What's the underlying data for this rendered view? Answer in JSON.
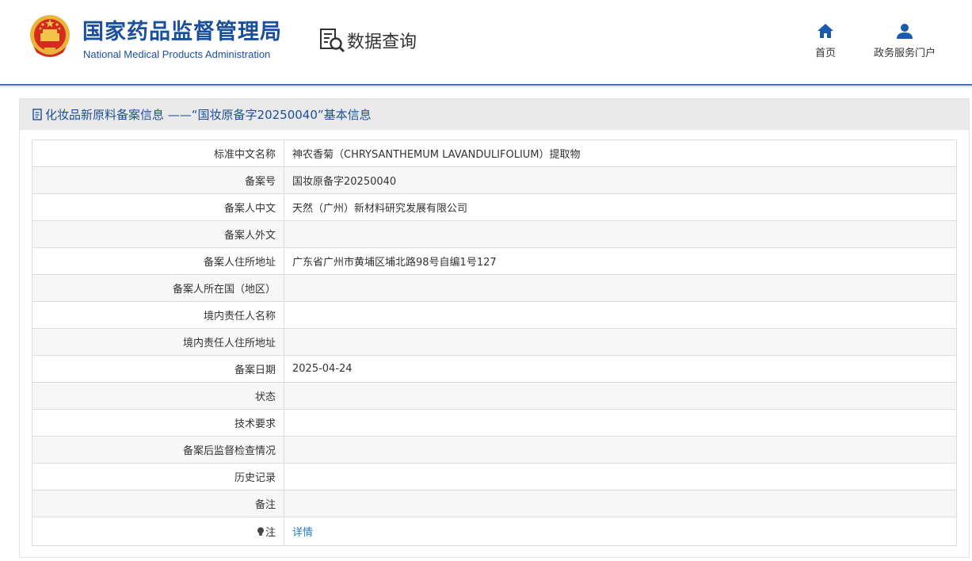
{
  "header": {
    "org_cn": "国家药品监督管理局",
    "org_en": "National Medical Products Administration",
    "query_title": "数据查询",
    "nav": {
      "home": "首页",
      "portal": "政务服务门户"
    }
  },
  "panel": {
    "title": "化妆品新原料备案信息 ——“国妆原备字20250040”基本信息"
  },
  "rows": [
    {
      "label": "标准中文名称",
      "value": "神农香菊（CHRYSANTHEMUM LAVANDULIFOLIUM）提取物"
    },
    {
      "label": "备案号",
      "value": "国妆原备字20250040"
    },
    {
      "label": "备案人中文",
      "value": "天然（广州）新材料研究发展有限公司"
    },
    {
      "label": "备案人外文",
      "value": ""
    },
    {
      "label": "备案人住所地址",
      "value": "广东省广州市黄埔区埔北路98号自编1号127"
    },
    {
      "label": "备案人所在国（地区）",
      "value": ""
    },
    {
      "label": "境内责任人名称",
      "value": ""
    },
    {
      "label": "境内责任人住所地址",
      "value": ""
    },
    {
      "label": "备案日期",
      "value": "2025-04-24"
    },
    {
      "label": "状态",
      "value": ""
    },
    {
      "label": "技术要求",
      "value": ""
    },
    {
      "label": "备案后监督检查情况",
      "value": ""
    },
    {
      "label": "历史记录",
      "value": ""
    },
    {
      "label": "备注",
      "value": ""
    }
  ],
  "note": {
    "label": "注",
    "link": "详情"
  },
  "colors": {
    "brand": "#1a4f9c",
    "link": "#2b7bc4",
    "header_line": "#3a6fb3"
  }
}
